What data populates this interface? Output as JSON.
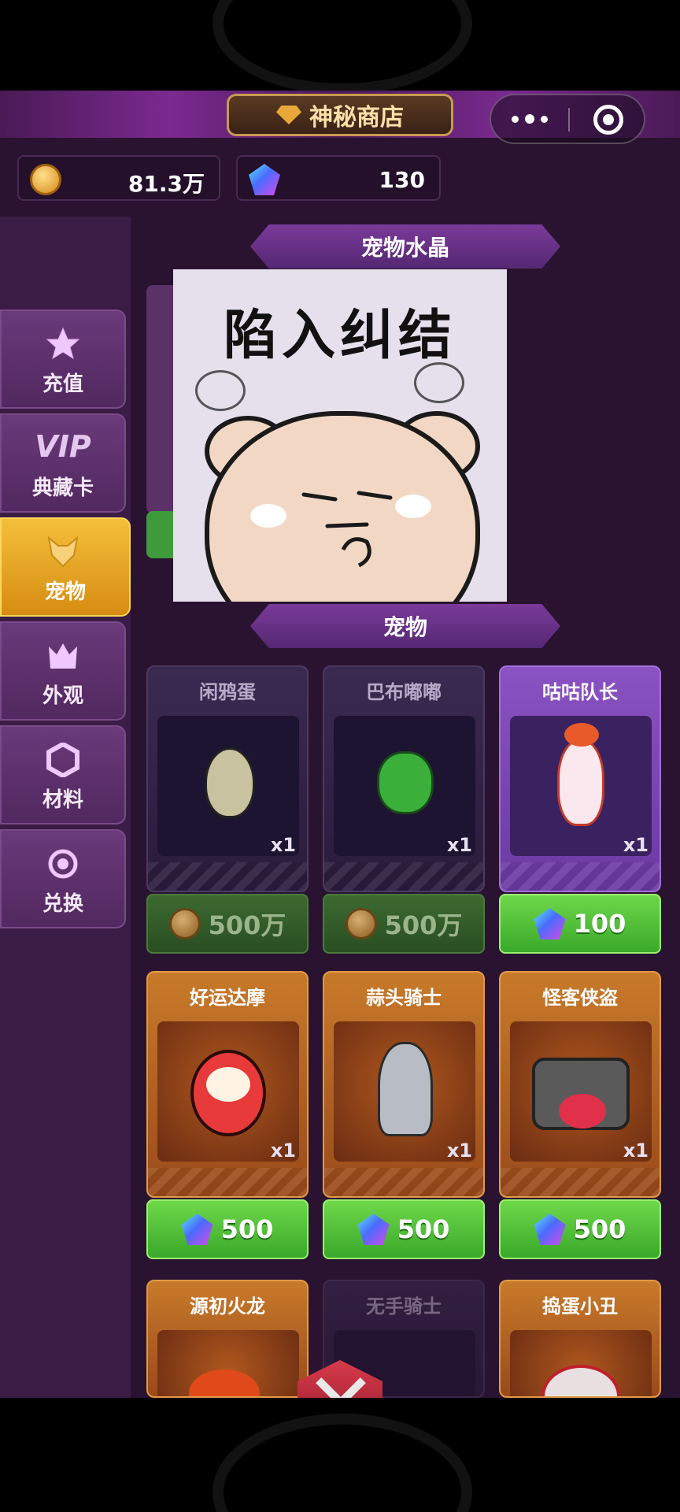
{
  "header": {
    "title": "神秘商店"
  },
  "currency": {
    "coins": "81.3万",
    "gems": "130"
  },
  "sidebar": {
    "tabs": [
      {
        "label": "充值",
        "icon": "star-icon",
        "active": false
      },
      {
        "label": "典藏卡",
        "glyph": "VIP",
        "icon": "vip-icon",
        "active": false
      },
      {
        "label": "宠物",
        "icon": "fox-icon",
        "active": true
      },
      {
        "label": "外观",
        "icon": "crown-icon",
        "active": false
      },
      {
        "label": "材料",
        "icon": "hexagon-nut-icon",
        "active": false
      },
      {
        "label": "兑换",
        "icon": "exchange-icon",
        "active": false
      }
    ]
  },
  "sections": {
    "crystal": "宠物水晶",
    "pets": "宠物"
  },
  "sticker": {
    "text": "陷入纠结"
  },
  "pets": [
    {
      "name": "闲鸦蛋",
      "qty": "x1",
      "price": "500万",
      "currency": "coin",
      "style": "dark"
    },
    {
      "name": "巴布嘟嘟",
      "qty": "x1",
      "price": "500万",
      "currency": "coin",
      "style": "dark"
    },
    {
      "name": "咕咕队长",
      "qty": "x1",
      "price": "100",
      "currency": "gem",
      "style": "purple"
    },
    {
      "name": "好运达摩",
      "qty": "x1",
      "price": "500",
      "currency": "gem",
      "style": "orange"
    },
    {
      "name": "蒜头骑士",
      "qty": "x1",
      "price": "500",
      "currency": "gem",
      "style": "orange"
    },
    {
      "name": "怪客侠盗",
      "qty": "x1",
      "price": "500",
      "currency": "gem",
      "style": "orange"
    },
    {
      "name": "源初火龙",
      "style": "orange"
    },
    {
      "name": "无手骑士",
      "style": "dark"
    },
    {
      "name": "捣蛋小丑",
      "style": "orange"
    }
  ],
  "colors": {
    "accent_gold": "#f4bf3a",
    "buy_green": "#4cc83a",
    "header_purple": "#7a2a90"
  }
}
